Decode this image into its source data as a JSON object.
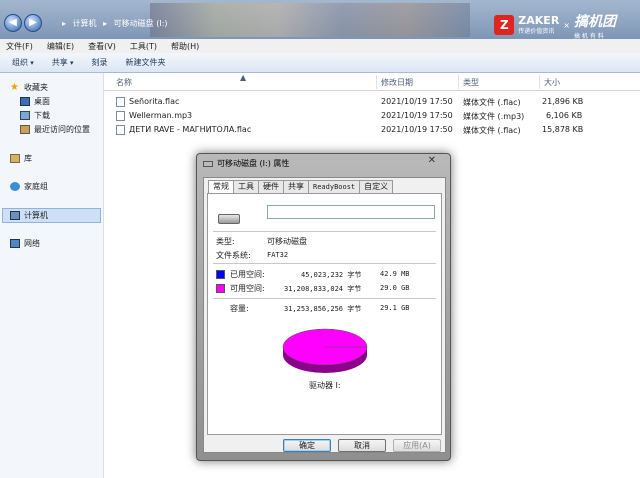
{
  "address": {
    "crumbs": [
      "▸",
      "计算机",
      "▸",
      "可移动磁盘 (I:)"
    ],
    "back_icon": "back-arrow-icon",
    "forward_icon": "forward-arrow-icon"
  },
  "brand": {
    "mark": "Z",
    "name": "ZAKER",
    "sub": "传递价值资讯",
    "x": "×",
    "partner": "搞机团",
    "partner_sub": "搞 机 有 料"
  },
  "menu": [
    "文件(F)",
    "编辑(E)",
    "查看(V)",
    "工具(T)",
    "帮助(H)"
  ],
  "toolbar": {
    "organize": "组织",
    "share": "共享",
    "burn": "刻录",
    "new_folder": "新建文件夹"
  },
  "nav": {
    "favorites": "收藏夹",
    "desktop": "桌面",
    "downloads": "下载",
    "recent": "最近访问的位置",
    "libraries": "库",
    "homegroup": "家庭组",
    "computer": "计算机",
    "network": "网络"
  },
  "columns": {
    "name": "名称",
    "modified": "修改日期",
    "type": "类型",
    "size": "大小"
  },
  "files": [
    {
      "name": "Señorita.flac",
      "modified": "2021/10/19 17:50",
      "type": "媒体文件 (.flac)",
      "size": "21,896 KB"
    },
    {
      "name": "Wellerman.mp3",
      "modified": "2021/10/19 17:50",
      "type": "媒体文件 (.mp3)",
      "size": "6,106 KB"
    },
    {
      "name": "ДЕТИ RAVE - МАГНИТОЛА.flac",
      "modified": "2021/10/19 17:50",
      "type": "媒体文件 (.flac)",
      "size": "15,878 KB"
    }
  ],
  "dialog": {
    "title": "可移动磁盘 (I:) 属性",
    "close": "✕",
    "tabs": [
      "常规",
      "工具",
      "硬件",
      "共享",
      "ReadyBoost",
      "自定义"
    ],
    "name_value": "",
    "type_label": "类型:",
    "type_value": "可移动磁盘",
    "fs_label": "文件系统:",
    "fs_value": "FAT32",
    "used_label": "已用空间:",
    "used_bytes": "45,023,232 字节",
    "used_size": "42.9 MB",
    "free_label": "可用空间:",
    "free_bytes": "31,208,833,024 字节",
    "free_size": "29.0 GB",
    "cap_label": "容量:",
    "cap_bytes": "31,253,856,256 字节",
    "cap_size": "29.1 GB",
    "drive_label": "驱动器 I:",
    "used_color": "#0000ff",
    "free_color": "#ff00ff",
    "used_fraction": 0.0014,
    "ok": "确定",
    "cancel": "取消",
    "apply": "应用(A)"
  }
}
